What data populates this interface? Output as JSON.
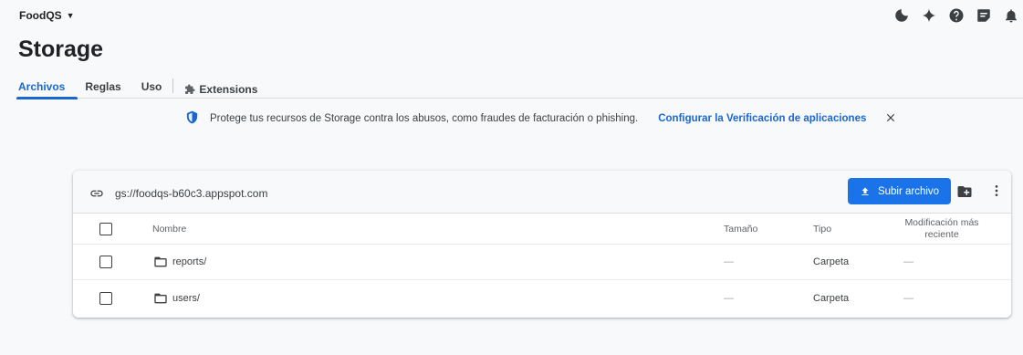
{
  "topbar": {
    "project": "FoodQS",
    "icons": [
      "moon-icon",
      "sparkle-icon",
      "help-icon",
      "feedback-icon",
      "bell-icon"
    ]
  },
  "page": {
    "title": "Storage"
  },
  "tabs": [
    {
      "label": "Archivos",
      "active": true
    },
    {
      "label": "Reglas"
    },
    {
      "label": "Uso"
    },
    {
      "label": "Extensions"
    }
  ],
  "banner": {
    "text": "Protege tus recursos de Storage contra los abusos, como fraudes de facturación o phishing.",
    "link": "Configurar la Verificación de aplicaciones"
  },
  "bucket": {
    "path": "gs://foodqs-b60c3.appspot.com",
    "upload_label": "Subir archivo"
  },
  "table": {
    "columns": {
      "name": "Nombre",
      "size": "Tamaño",
      "type": "Tipo",
      "modified": "Modificación más reciente"
    },
    "rows": [
      {
        "name": "reports/",
        "size": "—",
        "type": "Carpeta",
        "modified": "—"
      },
      {
        "name": "users/",
        "size": "—",
        "type": "Carpeta",
        "modified": "—"
      }
    ]
  },
  "colors": {
    "accent": "#1a73e8",
    "link": "#1967d2",
    "background": "#f8f9fa"
  }
}
